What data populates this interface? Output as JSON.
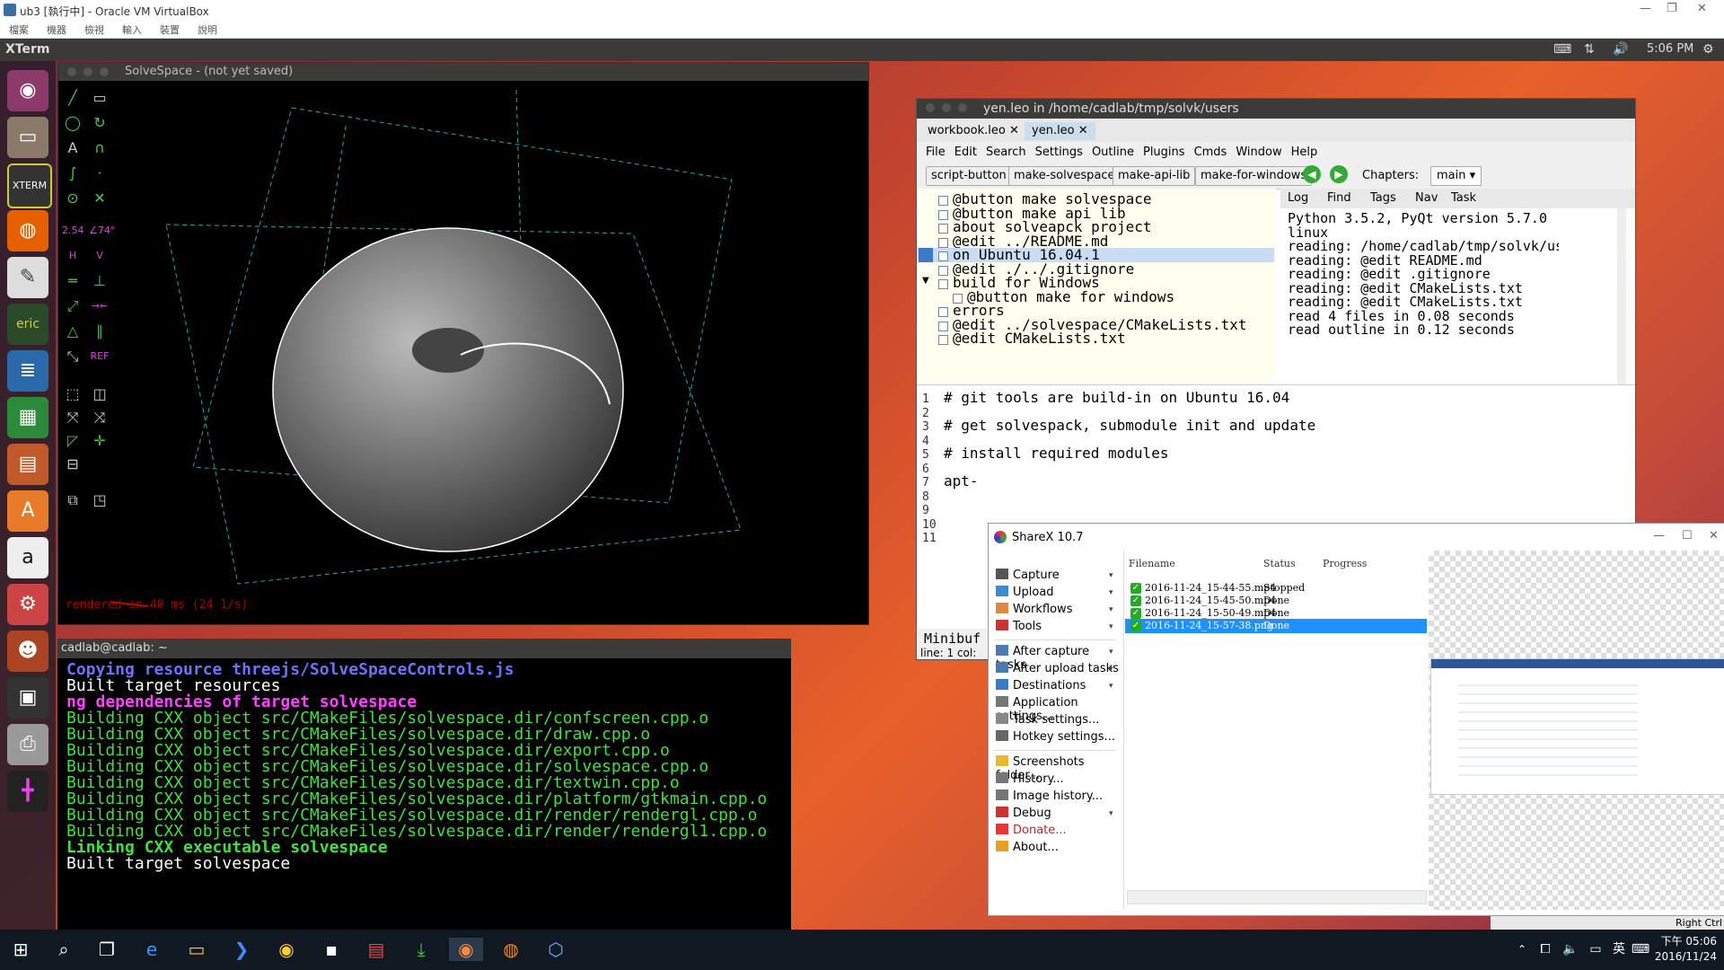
{
  "virtualbox": {
    "title": "ub3 [執行中] - Oracle VM VirtualBox",
    "menu": [
      "檔案",
      "機器",
      "檢視",
      "輸入",
      "裝置",
      "說明"
    ],
    "status_key": "Right Ctrl"
  },
  "ubuntu_panel": {
    "app_name": "XTerm",
    "clock": "5:06 PM"
  },
  "launcher": {
    "items": [
      "ubuntu-dash-icon",
      "files-icon",
      "xterm-icon",
      "firefox-icon",
      "text-editor-icon",
      "eric-icon",
      "writer-icon",
      "calc-icon",
      "impress-icon",
      "software-center-icon",
      "amazon-icon",
      "settings-icon",
      "game-icon",
      "terminal-icon",
      "printer-icon",
      "solvespace-icon"
    ]
  },
  "solvespace": {
    "title": "SolveSpace - (not yet saved)",
    "status": "rendered in 40 ms (24 1/s)"
  },
  "xterm": {
    "title": "cadlab@cadlab: ~",
    "lines": [
      {
        "text": "Copying resource threejs/SolveSpaceControls.js",
        "color": "#7070ff",
        "bold": true
      },
      {
        "text": "Built target resources",
        "color": "#ffffff",
        "bold": false
      },
      {
        "text": "ng dependencies of target solvespace",
        "color": "#ff40ff",
        "bold": true
      },
      {
        "text": "Building CXX object src/CMakeFiles/solvespace.dir/confscreen.cpp.o",
        "color": "#40e040",
        "bold": false
      },
      {
        "text": "Building CXX object src/CMakeFiles/solvespace.dir/draw.cpp.o",
        "color": "#40e040",
        "bold": false
      },
      {
        "text": "Building CXX object src/CMakeFiles/solvespace.dir/export.cpp.o",
        "color": "#40e040",
        "bold": false
      },
      {
        "text": "Building CXX object src/CMakeFiles/solvespace.dir/solvespace.cpp.o",
        "color": "#40e040",
        "bold": false
      },
      {
        "text": "Building CXX object src/CMakeFiles/solvespace.dir/textwin.cpp.o",
        "color": "#40e040",
        "bold": false
      },
      {
        "text": "Building CXX object src/CMakeFiles/solvespace.dir/platform/gtkmain.cpp.o",
        "color": "#40e040",
        "bold": false
      },
      {
        "text": "Building CXX object src/CMakeFiles/solvespace.dir/render/rendergl.cpp.o",
        "color": "#40e040",
        "bold": false
      },
      {
        "text": "Building CXX object src/CMakeFiles/solvespace.dir/render/rendergl1.cpp.o",
        "color": "#40e040",
        "bold": false
      },
      {
        "text": "Linking CXX executable solvespace",
        "color": "#40e040",
        "bold": true
      },
      {
        "text": "Built target solvespace",
        "color": "#ffffff",
        "bold": false
      }
    ]
  },
  "leo": {
    "title": "yen.leo in /home/cadlab/tmp/solvk/users",
    "tabs": [
      "workbook.leo",
      "yen.leo"
    ],
    "menu": [
      "File",
      "Edit",
      "Search",
      "Settings",
      "Outline",
      "Plugins",
      "Cmds",
      "Window",
      "Help"
    ],
    "buttons": [
      "script-button",
      "make-solvespace",
      "make-api-lib",
      "make-for-windows"
    ],
    "chapters_label": "Chapters:",
    "chapters_value": "main",
    "outline": [
      {
        "text": "@button make solvespace",
        "indent": 0,
        "selected": false
      },
      {
        "text": "@button make api lib",
        "indent": 0,
        "selected": false
      },
      {
        "text": "about solveapck project",
        "indent": 0,
        "selected": false
      },
      {
        "text": "@edit ../README.md",
        "indent": 0,
        "selected": false
      },
      {
        "text": "on Ubuntu 16.04.1",
        "indent": 0,
        "selected": true
      },
      {
        "text": "@edit ./../.gitignore",
        "indent": 0,
        "selected": false
      },
      {
        "text": "build for Windows",
        "indent": 0,
        "selected": false
      },
      {
        "text": "@button make for windows",
        "indent": 1,
        "selected": false
      },
      {
        "text": "errors",
        "indent": 0,
        "selected": false
      },
      {
        "text": "@edit ../solvespace/CMakeLists.txt",
        "indent": 0,
        "selected": false
      },
      {
        "text": "@edit CMakeLists.txt",
        "indent": 0,
        "selected": false
      }
    ],
    "log_tabs": [
      "Log",
      "Find",
      "Tags",
      "Nav",
      "Task"
    ],
    "log": [
      "Python 3.5.2, PyQt version 5.7.0",
      "linux",
      "reading: /home/cadlab/tmp/solvk/users/",
      "reading: @edit README.md",
      "reading: @edit .gitignore",
      "reading: @edit CMakeLists.txt",
      "reading: @edit CMakeLists.txt",
      "read 4 files in 0.08 seconds",
      "read outline in 0.12 seconds"
    ],
    "body_lines": [
      {
        "num": "1",
        "text": "# git tools are build-in on Ubuntu 16.04"
      },
      {
        "num": "2",
        "text": ""
      },
      {
        "num": "3",
        "text": "# get solvespack, submodule init and update"
      },
      {
        "num": "4",
        "text": ""
      },
      {
        "num": "5",
        "text": "# install required modules"
      },
      {
        "num": "6",
        "text": ""
      },
      {
        "num": "7",
        "text": "apt-"
      },
      {
        "num": "8",
        "text": ""
      },
      {
        "num": "9",
        "text": ""
      },
      {
        "num": "10",
        "text": ""
      },
      {
        "num": "11",
        "text": ""
      }
    ],
    "minibuffer": "Minibuf",
    "status": "line: 1 col:"
  },
  "sharex": {
    "title": "ShareX 10.7",
    "menu": [
      {
        "label": "Capture",
        "icon": "camera-icon",
        "arrow": true
      },
      {
        "label": "Upload",
        "icon": "upload-icon",
        "arrow": true
      },
      {
        "label": "Workflows",
        "icon": "grid-icon",
        "arrow": true
      },
      {
        "label": "Tools",
        "icon": "toolbox-icon",
        "arrow": true
      },
      {
        "label": "After capture tasks",
        "icon": "tasks-icon",
        "arrow": true
      },
      {
        "label": "After upload tasks",
        "icon": "upload-tasks-icon",
        "arrow": true
      },
      {
        "label": "Destinations",
        "icon": "globe-icon",
        "arrow": true
      },
      {
        "label": "Application settings...",
        "icon": "wrench-icon",
        "arrow": false
      },
      {
        "label": "Task settings...",
        "icon": "gear-icon",
        "arrow": false
      },
      {
        "label": "Hotkey settings...",
        "icon": "keyboard-icon",
        "arrow": false
      },
      {
        "label": "Screenshots folder...",
        "icon": "folder-icon",
        "arrow": false
      },
      {
        "label": "History...",
        "icon": "history-icon",
        "arrow": false
      },
      {
        "label": "Image history...",
        "icon": "image-history-icon",
        "arrow": false
      },
      {
        "label": "Debug",
        "icon": "bug-icon",
        "arrow": true
      },
      {
        "label": "Donate...",
        "icon": "heart-icon",
        "arrow": false
      },
      {
        "label": "About...",
        "icon": "crown-icon",
        "arrow": false
      }
    ],
    "columns": [
      "Filename",
      "Status",
      "Progress"
    ],
    "files": [
      {
        "name": "2016-11-24_15-44-55.mp4",
        "status": "Stopped",
        "selected": false
      },
      {
        "name": "2016-11-24_15-45-50.mp4",
        "status": "Done",
        "selected": false
      },
      {
        "name": "2016-11-24_15-50-49.mp4",
        "status": "Done",
        "selected": false
      },
      {
        "name": "2016-11-24_15-57-38.png",
        "status": "Done",
        "selected": true
      }
    ]
  },
  "taskbar": {
    "time": "下午 05:06",
    "date": "2016/11/24",
    "ime": "英"
  }
}
